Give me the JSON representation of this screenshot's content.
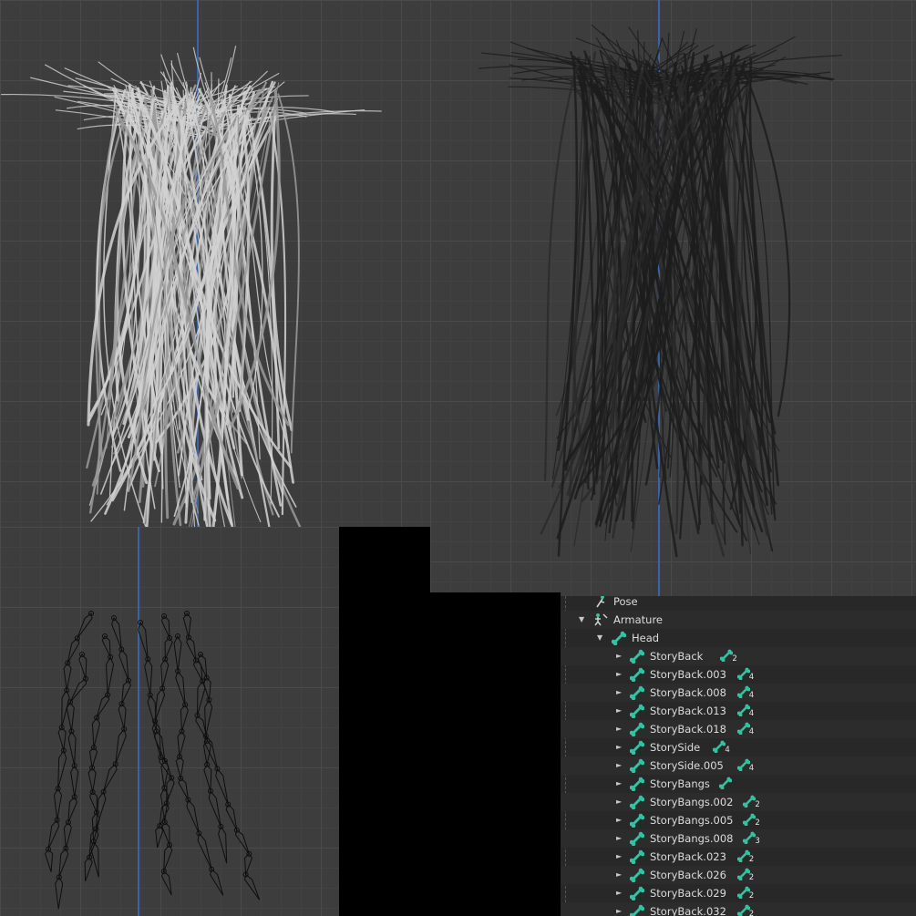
{
  "viewports": {
    "solid": "solid-shaded-viewport",
    "wire": "wireframe-viewport",
    "bones": "armature-viewport"
  },
  "colors": {
    "bone_icon": "#2fc4a3",
    "axis_line": "#3a64a6",
    "grid_bg": "#3d3d3d",
    "outliner_bg": "#282828"
  },
  "outliner": {
    "pose_label": "Pose",
    "armature_label": "Armature",
    "head_label": "Head",
    "bones": [
      {
        "label": "StoryBack",
        "count": "2"
      },
      {
        "label": "StoryBack.003",
        "count": "4"
      },
      {
        "label": "StoryBack.008",
        "count": "4"
      },
      {
        "label": "StoryBack.013",
        "count": "4"
      },
      {
        "label": "StoryBack.018",
        "count": "4"
      },
      {
        "label": "StorySide",
        "count": "4"
      },
      {
        "label": "StorySide.005",
        "count": "4"
      },
      {
        "label": "StoryBangs",
        "count": ""
      },
      {
        "label": "StoryBangs.002",
        "count": "2"
      },
      {
        "label": "StoryBangs.005",
        "count": "2"
      },
      {
        "label": "StoryBangs.008",
        "count": "3"
      },
      {
        "label": "StoryBack.023",
        "count": "2"
      },
      {
        "label": "StoryBack.026",
        "count": "2"
      },
      {
        "label": "StoryBack.029",
        "count": "2"
      },
      {
        "label": "StoryBack.032",
        "count": "2"
      }
    ]
  }
}
